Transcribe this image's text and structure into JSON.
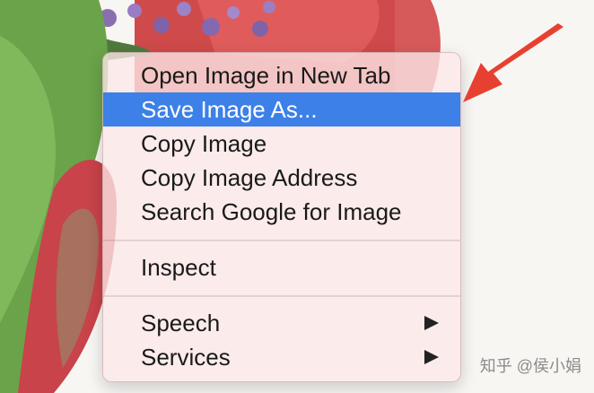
{
  "menu": {
    "items": [
      {
        "label": "Open Image in New Tab"
      },
      {
        "label": "Save Image As..."
      },
      {
        "label": "Copy Image"
      },
      {
        "label": "Copy Image Address"
      },
      {
        "label": "Search Google for Image"
      },
      {
        "label": "Inspect"
      },
      {
        "label": "Speech"
      },
      {
        "label": "Services"
      }
    ],
    "selected_index": 1,
    "selected_color": "#3c80e8",
    "submenu_icon": "triangle-right-icon"
  },
  "annotation": {
    "arrow_color": "#e84030",
    "arrow_icon": "red-arrow-icon"
  },
  "watermark": {
    "text": "知乎 @侯小娟"
  }
}
